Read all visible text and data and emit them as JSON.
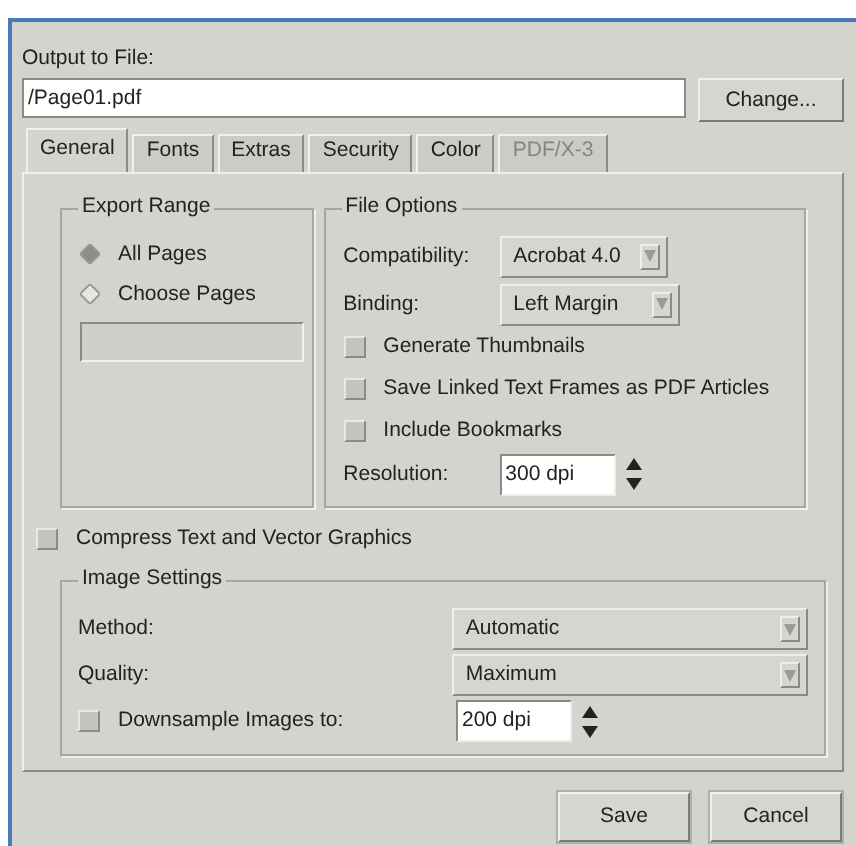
{
  "output": {
    "label": "Output to File:",
    "value": "/Page01.pdf",
    "button": "Change..."
  },
  "tabs": [
    {
      "label": "General",
      "selected": true,
      "disabled": false
    },
    {
      "label": "Fonts",
      "selected": false,
      "disabled": false
    },
    {
      "label": "Extras",
      "selected": false,
      "disabled": false
    },
    {
      "label": "Security",
      "selected": false,
      "disabled": false
    },
    {
      "label": "Color",
      "selected": false,
      "disabled": false
    },
    {
      "label": "PDF/X-3",
      "selected": false,
      "disabled": true
    }
  ],
  "export_range": {
    "title": "Export Range",
    "options": [
      {
        "label": "All Pages",
        "selected": true
      },
      {
        "label": "Choose Pages",
        "selected": false
      }
    ]
  },
  "file_options": {
    "title": "File Options",
    "compatibility": {
      "label": "Compatibility:",
      "value": "Acrobat 4.0"
    },
    "binding": {
      "label": "Binding:",
      "value": "Left Margin"
    },
    "checks": [
      {
        "label": "Generate Thumbnails",
        "checked": false
      },
      {
        "label": "Save Linked Text Frames as PDF Articles",
        "checked": false
      },
      {
        "label": "Include Bookmarks",
        "checked": false
      }
    ],
    "resolution": {
      "label": "Resolution:",
      "value": "300 dpi"
    }
  },
  "compress": {
    "label": "Compress Text and Vector Graphics",
    "checked": false
  },
  "image_settings": {
    "title": "Image Settings",
    "method": {
      "label": "Method:",
      "value": "Automatic"
    },
    "quality": {
      "label": "Quality:",
      "value": "Maximum"
    },
    "downsample": {
      "label": "Downsample Images to:",
      "checked": false,
      "value": "200 dpi"
    }
  },
  "buttons": [
    "Save",
    "Cancel"
  ]
}
